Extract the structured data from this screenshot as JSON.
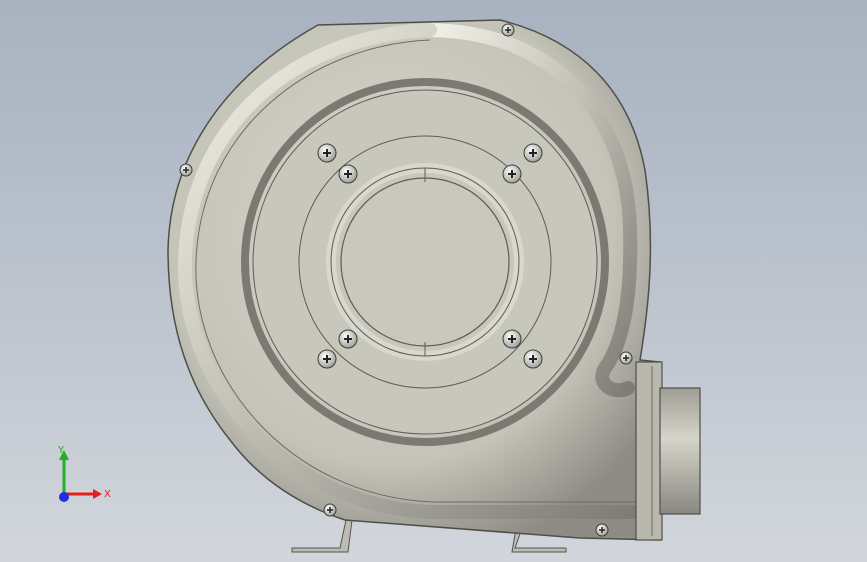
{
  "viewport": {
    "background_top": "#a8b2c0",
    "background_bottom": "#d2d6dc"
  },
  "model": {
    "part": "centrifugal-blower-housing",
    "body_color": "#c9c8bd",
    "shadow_color": "#6f6e67",
    "screw_count_face": 8,
    "perimeter_screw_count": 5
  },
  "triad": {
    "x_label": "X",
    "y_label": "Y",
    "x_color": "#e02020",
    "y_color": "#20b020",
    "z_color": "#2030e0"
  }
}
